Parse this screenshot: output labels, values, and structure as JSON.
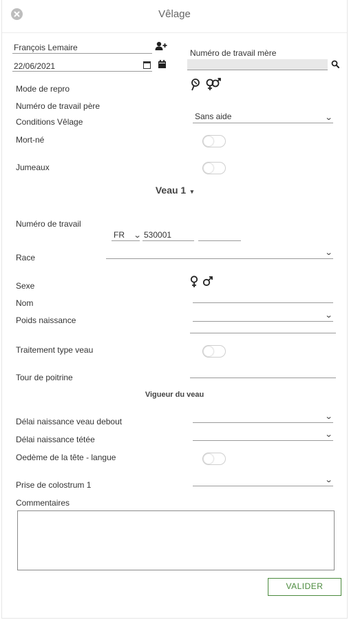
{
  "header": {
    "title": "Vêlage",
    "close_icon": "close-icon"
  },
  "owner": {
    "name": "François Lemaire",
    "add_icon": "add-person-icon"
  },
  "date": {
    "value": "22/06/2021",
    "calendar_icon": "calendar-icon"
  },
  "mother": {
    "label": "Numéro de travail mère",
    "value": "",
    "search_icon": "search-icon"
  },
  "repro": {
    "label": "Mode de repro",
    "icons": [
      "natural-service-icon",
      "male-female-icon"
    ]
  },
  "father": {
    "label": "Numéro de travail père"
  },
  "conditions": {
    "label": "Conditions Vêlage",
    "value": "Sans aide"
  },
  "stillborn": {
    "label": "Mort-né"
  },
  "twins": {
    "label": "Jumeaux"
  },
  "calf": {
    "title": "Veau 1",
    "work_number_label": "Numéro de travail",
    "country": "FR",
    "work_number": "530001",
    "work_number_suffix": "",
    "breed_label": "Race",
    "breed_value": "",
    "sex_label": "Sexe",
    "name_label": "Nom",
    "weight_label": "Poids naissance",
    "treatment_label": "Traitement type veau",
    "chest_label": "Tour de poitrine"
  },
  "vigor": {
    "title": "Vigueur du veau",
    "standing_label": "Délai naissance veau debout",
    "suckling_label": "Délai naissance tétée",
    "edema_label": "Oedème de la tête - langue",
    "colostrum_label": "Prise de colostrum 1",
    "comments_label": "Commentaires"
  },
  "actions": {
    "submit_label": "VALIDER"
  },
  "colors": {
    "accent_green": "#4a8a3c",
    "text": "#333333",
    "input_bg": "#e8e8e8"
  }
}
